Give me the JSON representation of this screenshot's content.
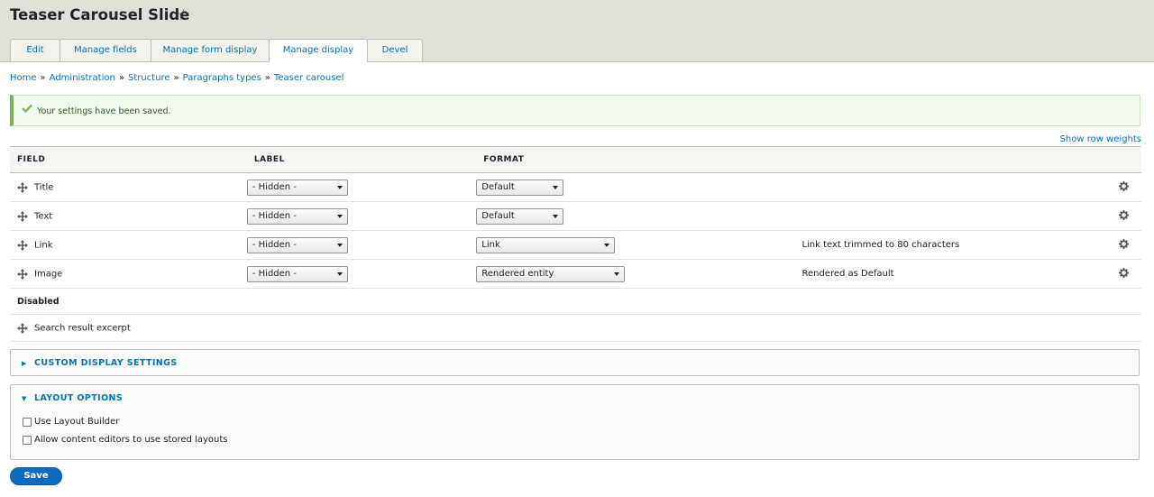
{
  "header": {
    "title": "Teaser Carousel Slide",
    "star": "☆",
    "tabs": [
      "Edit",
      "Manage fields",
      "Manage form display",
      "Manage display",
      "Devel"
    ],
    "active_tab": "Manage display"
  },
  "breadcrumb": [
    "Home",
    "Administration",
    "Structure",
    "Paragraphs types",
    "Teaser carousel"
  ],
  "breadcrumb_separator": "»",
  "status_message": "Your settings have been saved.",
  "show_row_weights": "Show row weights",
  "table": {
    "headers": [
      "FIELD",
      "LABEL",
      "FORMAT"
    ],
    "rows": [
      {
        "name": "Title",
        "label": "- Hidden -",
        "format": "Default",
        "summary": ""
      },
      {
        "name": "Text",
        "label": "- Hidden -",
        "format": "Default",
        "summary": ""
      },
      {
        "name": "Link",
        "label": "- Hidden -",
        "format": "Link",
        "summary": "Link text trimmed to 80 characters"
      },
      {
        "name": "Image",
        "label": "- Hidden -",
        "format": "Rendered entity",
        "summary": "Rendered as Default"
      }
    ],
    "disabled_region": "Disabled",
    "disabled_rows": [
      {
        "name": "Search result excerpt"
      }
    ]
  },
  "custom_display": {
    "title": "CUSTOM DISPLAY SETTINGS",
    "expanded": false
  },
  "layout_options": {
    "title": "LAYOUT OPTIONS",
    "expanded": true,
    "options": [
      {
        "label": "Use Layout Builder",
        "checked": false
      },
      {
        "label": "Allow content editors to use stored layouts",
        "checked": false
      }
    ]
  },
  "save_label": "Save",
  "colors": {
    "link": "#0074bd",
    "header_bg": "#e0e0d8",
    "status_border": "#77b259",
    "status_bg": "#f3faef",
    "button": "#0f6bbd"
  },
  "icons": {
    "drag": "drag-handle-icon",
    "gear": "gear-icon",
    "check": "check-icon",
    "collapsed": "triangle-right-icon",
    "expanded": "triangle-down-icon"
  }
}
